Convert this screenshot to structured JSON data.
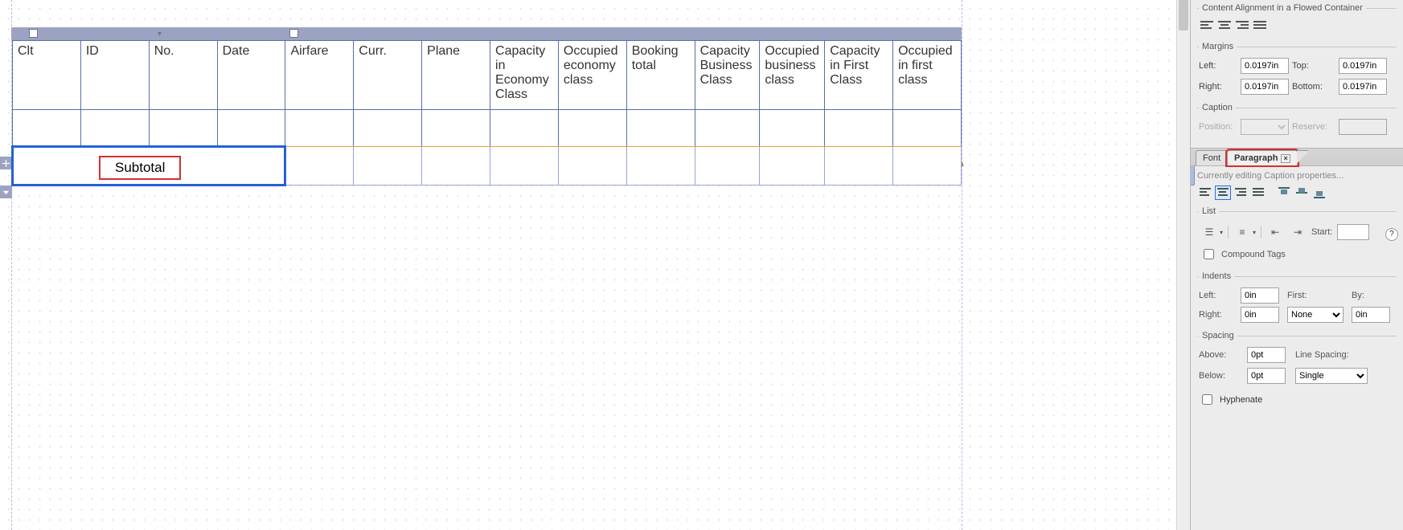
{
  "columns": [
    "Clt",
    "ID",
    "No.",
    "Date",
    "Airfare",
    "Curr.",
    "Plane",
    "Capacity in Economy Class",
    "Occupied economy class",
    "Booking total",
    "Capacity Business Class",
    "Occupied business class",
    "Capacity in First Class",
    "Occupied in first class"
  ],
  "footer": {
    "subtotal_label": "Subtotal"
  },
  "panel": {
    "content_alignment": {
      "legend": "Content Alignment in a Flowed Container"
    },
    "margins": {
      "legend": "Margins",
      "left_label": "Left:",
      "left_value": "0.0197in",
      "top_label": "Top:",
      "top_value": "0.0197in",
      "right_label": "Right:",
      "right_value": "0.0197in",
      "bottom_label": "Bottom:",
      "bottom_value": "0.0197in"
    },
    "caption": {
      "legend": "Caption",
      "position_label": "Position:",
      "position_value": "",
      "reserve_label": "Reserve:",
      "reserve_value": ""
    },
    "tabs": {
      "font": "Font",
      "paragraph": "Paragraph"
    },
    "edit_note": "Currently editing Caption properties...",
    "list": {
      "legend": "List",
      "start_label": "Start:",
      "start_value": "",
      "compound_label": "Compound Tags"
    },
    "indents": {
      "legend": "Indents",
      "left_label": "Left:",
      "left_value": "0in",
      "right_label": "Right:",
      "right_value": "0in",
      "first_label": "First:",
      "first_value": "None",
      "by_label": "By:",
      "by_value": "0in"
    },
    "spacing": {
      "legend": "Spacing",
      "above_label": "Above:",
      "above_value": "0pt",
      "below_label": "Below:",
      "below_value": "0pt",
      "line_label": "Line Spacing:",
      "line_value": "Single"
    },
    "hyphenate_label": "Hyphenate",
    "help_glyph": "?"
  }
}
